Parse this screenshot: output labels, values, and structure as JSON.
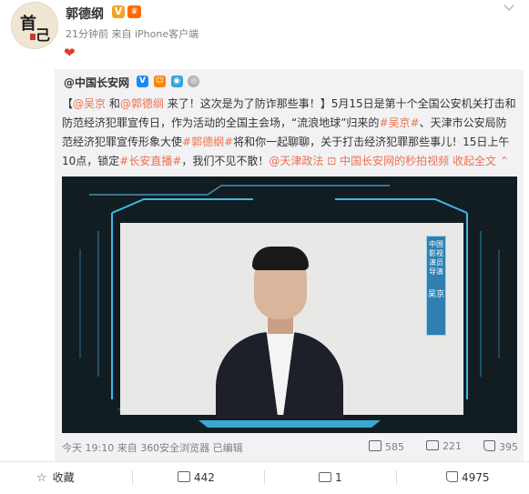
{
  "author": {
    "name": "郭德纲",
    "meta": "21分钟前 来自 iPhone客户端",
    "avatar_glyph_top": "首",
    "avatar_glyph_bottom": "己"
  },
  "heart": "❤",
  "repost": {
    "author": "@中国长安网",
    "text": {
      "p1": "【",
      "m1": "@吴京",
      "p2": " 和",
      "m2": "@郭德纲",
      "p3": " 来了！这次是为了防诈那些事！】5月15日是第十个全国公安机关打击和防范经济犯罪宣传日，作为活动的全国主会场，“流浪地球”归来的",
      "h1": "#吴京#",
      "p4": "、天津市公安局防范经济犯罪宣传形象大使",
      "h2": "#郭德纲#",
      "p5": "将和你一起聊聊，关于打击经济犯罪那些事儿！15日上午10点，锁定",
      "h3": "#长安直播#",
      "p6": "，我们不见不散！",
      "m3": "@天津政法",
      "link": "中国长安网的秒拍视频",
      "expand": "收起全文"
    },
    "video": {
      "label": "中国影视演员 导演",
      "name": "吴京"
    }
  },
  "repost_footer": {
    "time": "今天 19:10 来自 360安全浏览器 已编辑",
    "shares": "585",
    "comments": "221",
    "likes": "395"
  },
  "actions": {
    "favorite": "收藏",
    "reposts": "442",
    "comments": "1",
    "likes": "4975"
  }
}
